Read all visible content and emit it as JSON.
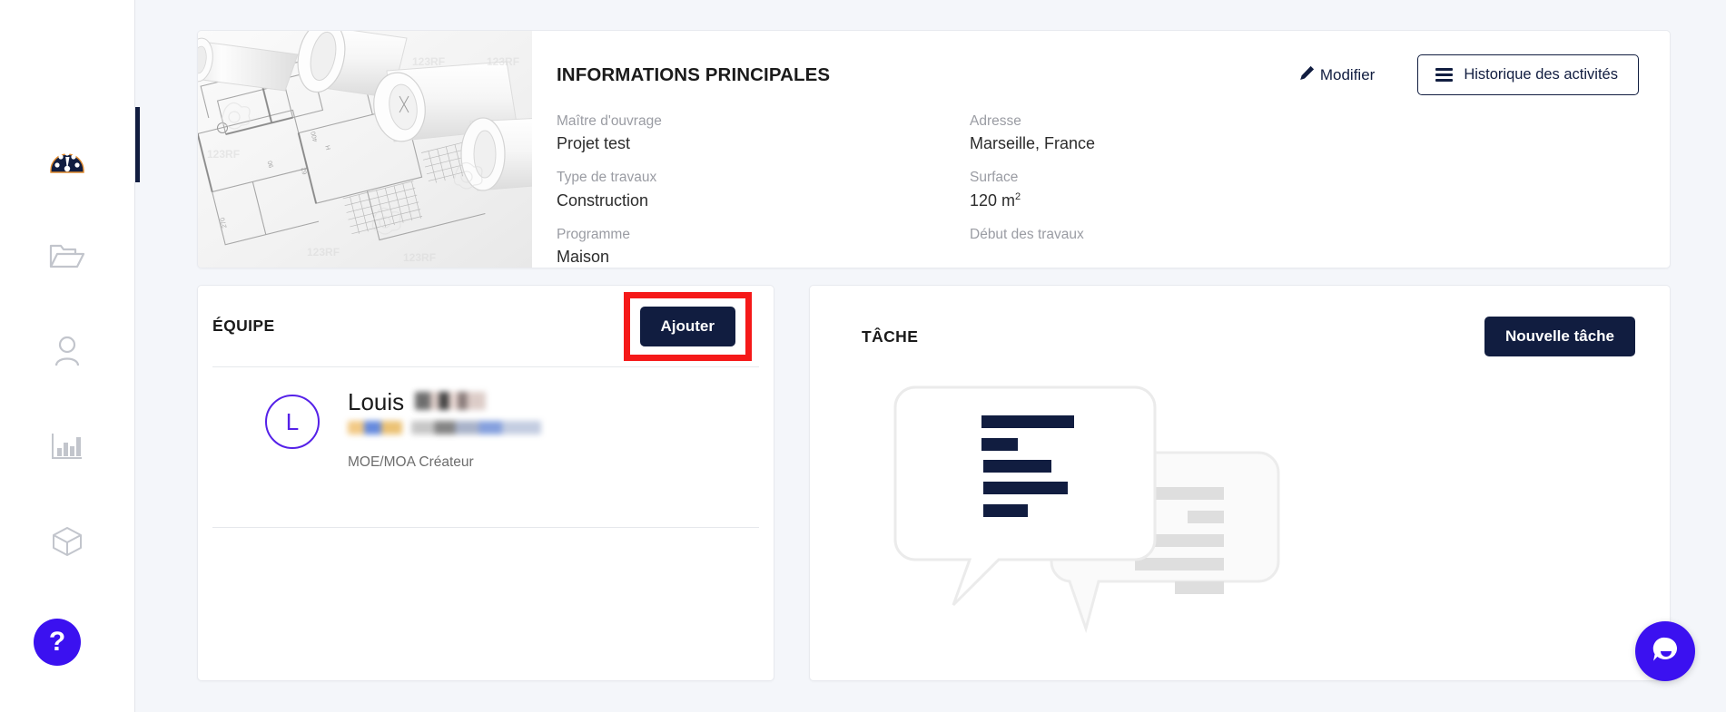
{
  "sidebar": {
    "items": [
      {
        "name": "dashboard",
        "icon": "gauge-icon",
        "active": true
      },
      {
        "name": "projects",
        "icon": "folder-open-icon",
        "active": false
      },
      {
        "name": "contacts",
        "icon": "user-icon",
        "active": false
      },
      {
        "name": "statistics",
        "icon": "bar-chart-icon",
        "active": false
      },
      {
        "name": "products",
        "icon": "cube-icon",
        "active": false
      }
    ],
    "help_label": "?"
  },
  "info_card": {
    "title": "INFORMATIONS PRINCIPALES",
    "edit_label": "Modifier",
    "history_label": "Historique des activités",
    "thumbnail_alt": "Plans d'architecte roulés",
    "fields_left": [
      {
        "label": "Maître d'ouvrage",
        "value": "Projet test"
      },
      {
        "label": "Type de travaux",
        "value": "Construction"
      },
      {
        "label": "Programme",
        "value": "Maison"
      }
    ],
    "fields_right": [
      {
        "label": "Adresse",
        "value": "Marseille, France"
      },
      {
        "label": "Surface",
        "value": "120 m",
        "sup": "2"
      },
      {
        "label": "Début des travaux",
        "value": ""
      }
    ]
  },
  "team_panel": {
    "title": "ÉQUIPE",
    "add_label": "Ajouter",
    "members": [
      {
        "initial": "L",
        "first_name": "Louis",
        "last_name_redacted": true,
        "email_redacted": true,
        "role": "MOE/MOA Créateur"
      }
    ]
  },
  "task_panel": {
    "title": "TÂCHE",
    "new_task_label": "Nouvelle tâche",
    "empty_illustration": "speech-bubbles-empty-state"
  },
  "chat_widget": {
    "icon": "chat-bubble-icon"
  },
  "colors": {
    "navy": "#111d40",
    "accent_purple": "#3b11f0",
    "avatar_purple": "#5521e8",
    "highlight_red": "#f51919",
    "page_bg": "#f4f6fa",
    "muted_text": "#9a9ca3"
  }
}
